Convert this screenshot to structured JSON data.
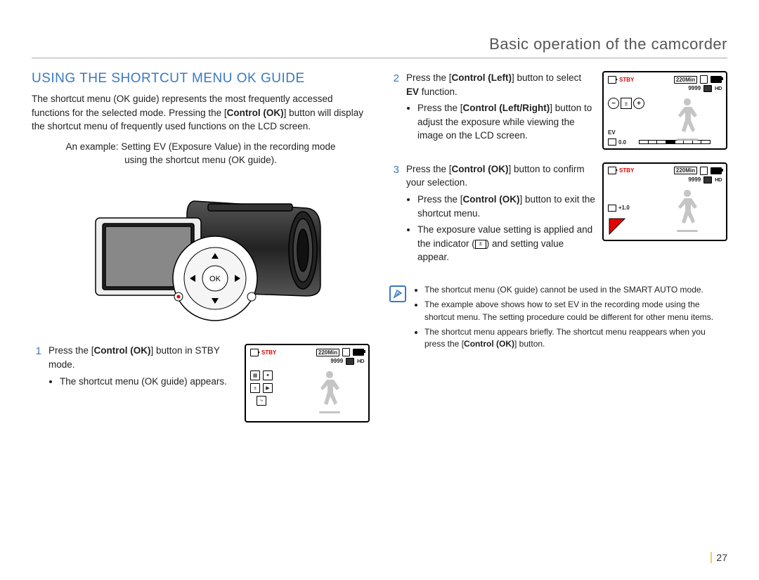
{
  "header": {
    "title": "Basic operation of the camcorder"
  },
  "section_title": "USING THE SHORTCUT MENU OK GUIDE",
  "intro": {
    "t1": "The shortcut menu (OK guide) represents the most frequently accessed functions for the selected mode. Pressing the [",
    "control_ok": "Control (OK)",
    "t2": "] button will display the shortcut menu of frequently used functions on the LCD screen."
  },
  "example": {
    "line1": "An example: Setting EV (Exposure Value) in the recording mode",
    "line2": "using the shortcut menu (OK guide)."
  },
  "steps": {
    "s1": {
      "num": "1",
      "t1": "Press the [",
      "b1": "Control (OK)",
      "t2": "] button in STBY mode.",
      "bullet1": "The shortcut menu (OK guide) appears."
    },
    "s2": {
      "num": "2",
      "t1": "Press the [",
      "b1": "Control (Left)",
      "t2": "] button to select ",
      "b2": "EV",
      "t3": " function.",
      "bullet1a": "Press the [",
      "bullet1b": "Control (Left/Right)",
      "bullet1c": "] button to adjust the exposure while viewing the image on the LCD screen."
    },
    "s3": {
      "num": "3",
      "t1": "Press the [",
      "b1": "Control (OK)",
      "t2": "] button to confirm your selection.",
      "bullet1a": "Press the [",
      "bullet1b": "Control (OK)",
      "bullet1c": "] button to exit the shortcut menu.",
      "bullet2a": "The exposure value setting is applied and the indicator (",
      "bullet2b": ") and setting value appear."
    }
  },
  "lcd": {
    "stby": "STBY",
    "time": "220Min",
    "shots": "9999",
    "hd": "HD",
    "ev_label": "EV",
    "ev_val_0": "0.0",
    "ev_val_1": "+1.0"
  },
  "notes": {
    "n1a": "The shortcut menu (OK guide) cannot be used in the SMART AUTO mode.",
    "n2a": "The example above shows how to set EV in the recording mode using the shortcut menu. The setting procedure could be different for other menu items.",
    "n3a": "The shortcut menu appears briefly. The shortcut menu reappears when you press the [",
    "n3b": "Control (OK)",
    "n3c": "] button."
  },
  "page_number": "27",
  "icons": {
    "ev": "±",
    "minus": "−",
    "plus": "+"
  }
}
